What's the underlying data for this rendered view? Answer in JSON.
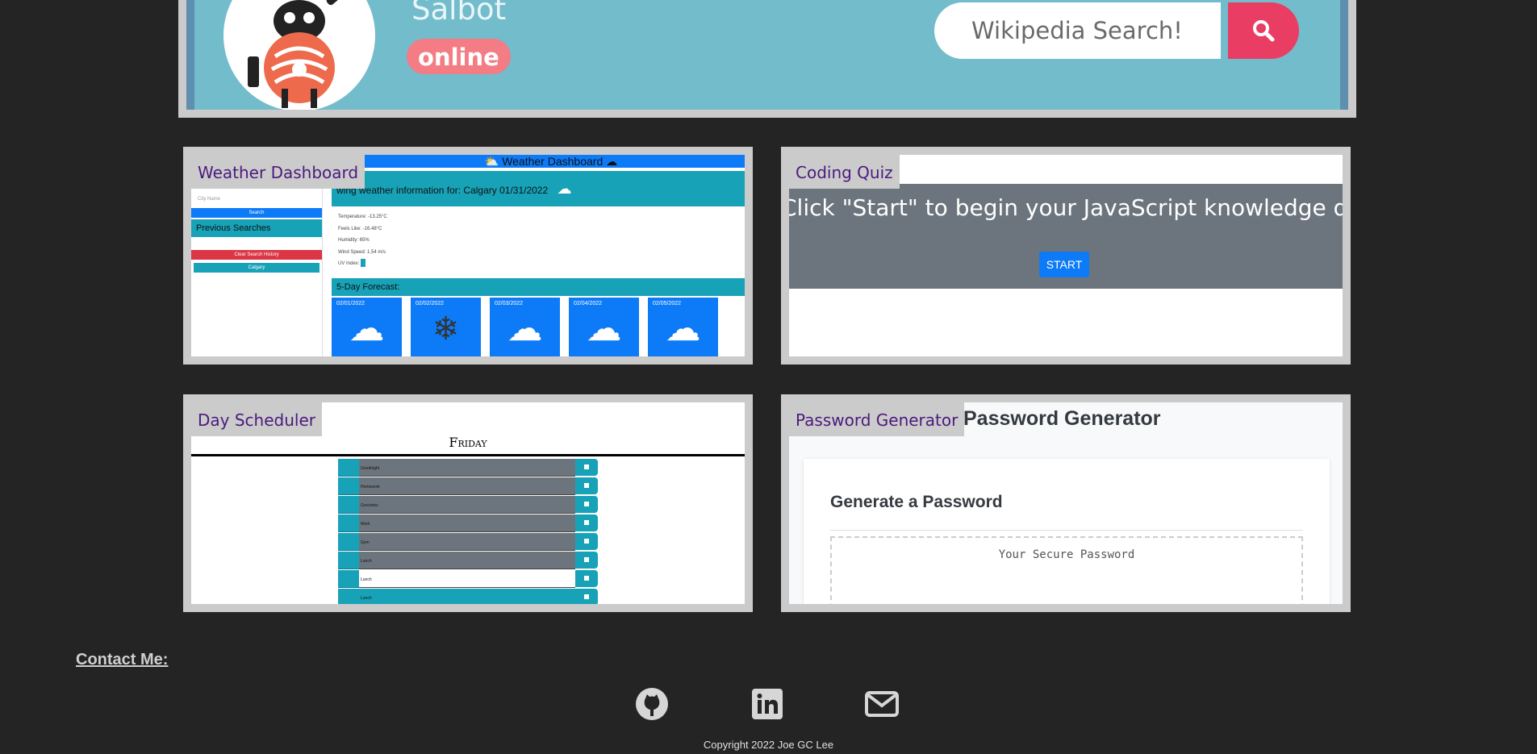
{
  "salbot": {
    "name": "Salbot",
    "status": "online",
    "search_placeholder": "Wikipedia Search!"
  },
  "projects": [
    {
      "title": "Weather Dashboard",
      "preview": {
        "heading": "Weather Dashboard",
        "city_placeholder": "City Name",
        "search_label": "Search",
        "previous_label": "Previous Searches",
        "clear_label": "Clear Search History",
        "history_item": "Calgary",
        "current_text": "wing weather information for: Calgary 01/31/2022",
        "stats": [
          "Temperature: -13.25°C",
          "Feels Like: -16.48°C",
          "Humidity: 65%",
          "Wind Speed: 1.54 m/s",
          "UV Index: "
        ],
        "forecast_label": "5-Day Forecast:",
        "forecast_dates": [
          "02/01/2022",
          "02/02/2022",
          "02/03/2022",
          "02/04/2022",
          "02/05/2022"
        ]
      }
    },
    {
      "title": "Coding Quiz",
      "preview": {
        "prompt": "Click \"Start\" to begin your JavaScript knowledge quiz!",
        "start_label": "START"
      }
    },
    {
      "title": "Day Scheduler",
      "preview": {
        "day": "Friday",
        "entries": [
          "Goodnight",
          "Homework",
          "Groceries",
          "Work",
          "Gym",
          "Lunch",
          "Lunch",
          "Lunch"
        ]
      }
    },
    {
      "title": "Password Generator",
      "preview": {
        "heading": "Password Generator",
        "subheading": "Generate a Password",
        "placeholder": "Your Secure Password"
      }
    }
  ],
  "footer": {
    "contact_label": "Contact Me:",
    "social_icons": [
      "github-icon",
      "linkedin-icon",
      "email-icon"
    ],
    "copyright": "Copyright 2022 Joe GC Lee"
  },
  "colors": {
    "background": "#242424",
    "card_frame": "#cbcbcb",
    "label_text": "#4b1a7e",
    "salbot_bg": "#73bccb",
    "salbot_accent": "#ea3d63",
    "bootstrap_primary": "#0d7bf7",
    "bootstrap_info": "#17a2b8"
  }
}
